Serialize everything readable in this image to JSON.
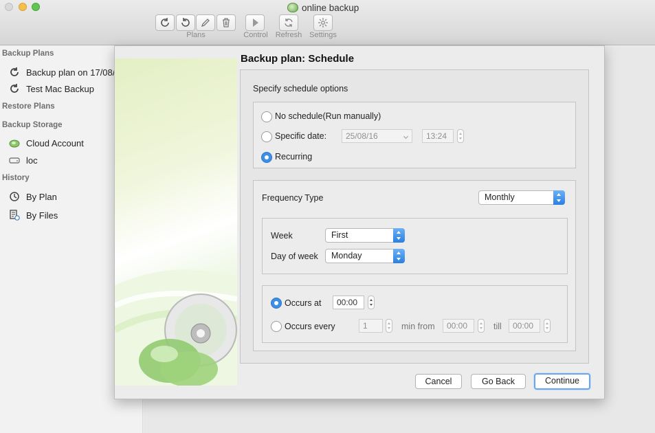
{
  "window": {
    "title": "online backup"
  },
  "toolbar": {
    "groups": [
      {
        "label": "Plans"
      },
      {
        "label": "Control"
      },
      {
        "label": "Refresh"
      },
      {
        "label": "Settings"
      }
    ]
  },
  "sidebar": {
    "backup_plans_heading": "Backup Plans",
    "backup_plans": [
      {
        "label": "Backup plan on 17/08/"
      },
      {
        "label": "Test Mac Backup"
      }
    ],
    "restore_plans_heading": "Restore Plans",
    "backup_storage_heading": "Backup Storage",
    "storage": [
      {
        "label": "Cloud Account"
      },
      {
        "label": "loc"
      }
    ],
    "history_heading": "History",
    "history": [
      {
        "label": "By Plan"
      },
      {
        "label": "By Files"
      }
    ]
  },
  "dialog": {
    "title": "Backup plan: Schedule",
    "section_label": "Specify schedule options",
    "options": {
      "no_schedule": "No schedule(Run manually)",
      "specific_date": "Specific date:",
      "specific_date_value": "25/08/16",
      "specific_time_value": "13:24",
      "recurring": "Recurring",
      "selected": "recurring"
    },
    "frequency": {
      "label": "Frequency Type",
      "value": "Monthly",
      "week_label": "Week",
      "week_value": "First",
      "day_label": "Day of week",
      "day_value": "Monday"
    },
    "occurs": {
      "at_label": "Occurs at",
      "at_value": "00:00",
      "every_label": "Occurs every",
      "every_value": "1",
      "min_from_label": "min from",
      "from_value": "00:00",
      "till_label": "till",
      "till_value": "00:00",
      "selected": "at"
    },
    "buttons": {
      "cancel": "Cancel",
      "go_back": "Go Back",
      "continue": "Continue"
    }
  },
  "colors": {
    "accent": "#3d8fe6",
    "art_green": "#8cc86a"
  }
}
